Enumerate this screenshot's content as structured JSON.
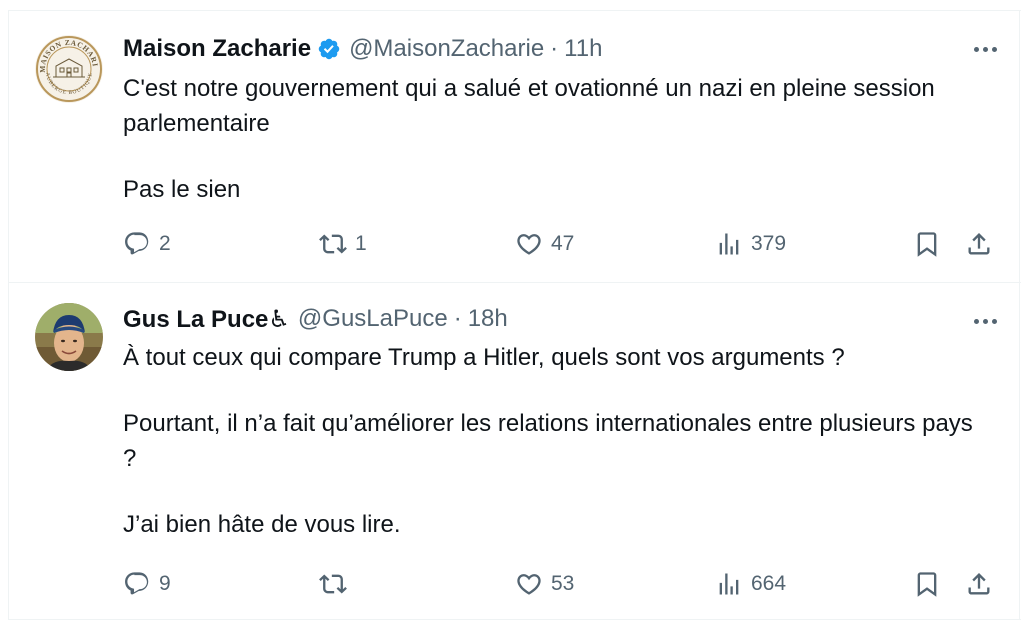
{
  "tweets": [
    {
      "name": "Maison Zacharie",
      "verified": true,
      "handle": "@MaisonZacharie",
      "separator": "·",
      "time": "11h",
      "avatar_text_top": "MAISON ZACHARIE",
      "avatar_text_bottom": "AUBERGE BOUTIQUE",
      "paragraphs": [
        "C'est notre gouvernement qui a salué et ovationné un nazi en pleine session parlementaire",
        "Pas le sien"
      ],
      "replies": "2",
      "reposts": "1",
      "likes": "47",
      "views": "379"
    },
    {
      "name": "Gus La Puce♿",
      "verified": false,
      "handle": "@GusLaPuce",
      "separator": "·",
      "time": "18h",
      "paragraphs": [
        "À tout ceux qui compare Trump a Hitler, quels sont vos arguments ?",
        "Pourtant, il n’a fait qu’améliorer les relations internationales entre plusieurs pays ?",
        "J’ai bien hâte de vous lire."
      ],
      "replies": "9",
      "reposts": "",
      "likes": "53",
      "views": "664"
    }
  ],
  "icons": {
    "reply": "reply-icon",
    "repost": "repost-icon",
    "like": "heart-icon",
    "views": "views-icon",
    "bookmark": "bookmark-icon",
    "share": "share-icon",
    "more": "more-icon",
    "verified": "verified-badge-icon"
  },
  "colors": {
    "text": "#0f1419",
    "secondary": "#536471",
    "verified": "#1d9bf0",
    "divider": "#eff3f4",
    "avatar_ring": "#b9975b"
  }
}
